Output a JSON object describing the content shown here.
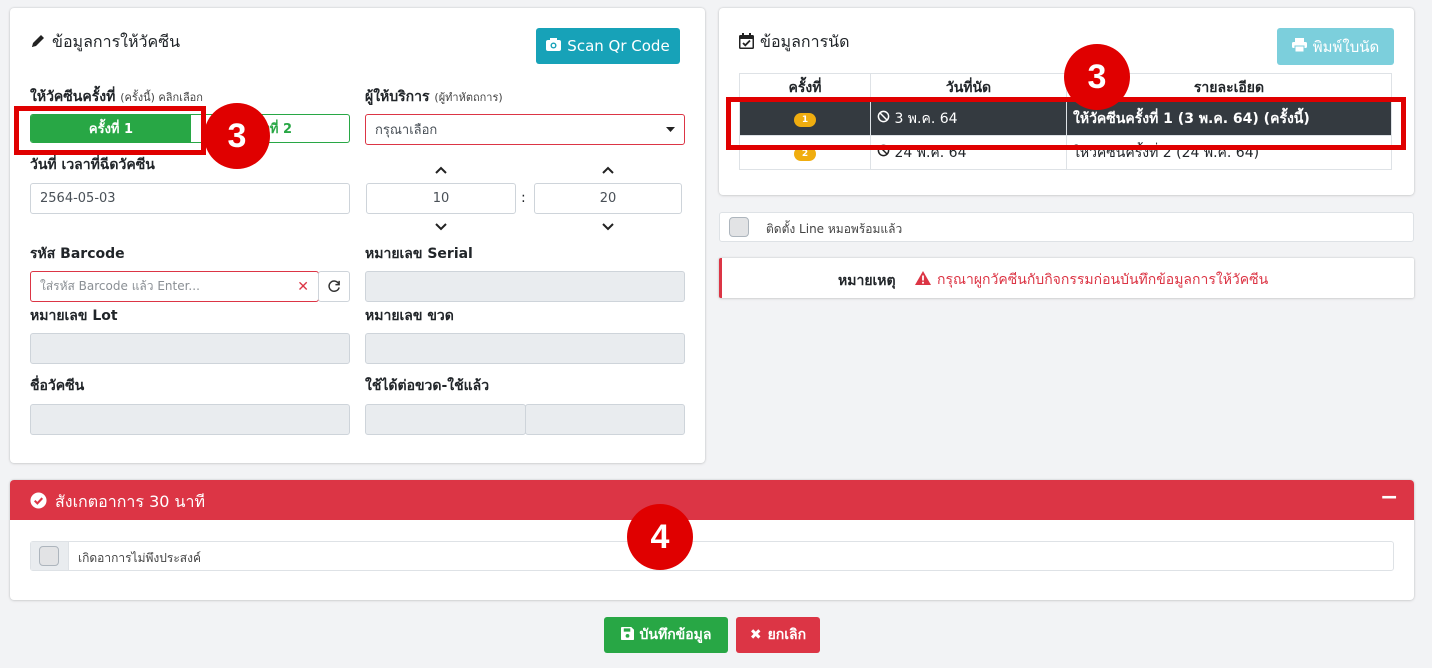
{
  "vaccine": {
    "title": "ข้อมูลการให้วัคซีน",
    "scan_button": "Scan Qr Code",
    "dose": {
      "label": "ให้วัคซีนครั้งที่",
      "hint": "(ครั้งนี้) คลิกเลือก",
      "option1": "ครั้งที่ 1",
      "option2": "ครั้งที่ 2"
    },
    "provider": {
      "label": "ผู้ให้บริการ",
      "hint": "(ผู้ทำหัตถการ)",
      "placeholder": "กรุณาเลือก"
    },
    "datetime": {
      "label": "วันที่ เวลาที่ฉีดวัคซีน",
      "date": "2564-05-03",
      "hour": "10",
      "minute": "20",
      "separator": ":"
    },
    "barcode": {
      "label": "รหัส Barcode",
      "placeholder": "ใส่รหัส Barcode แล้ว Enter..."
    },
    "serial_label": "หมายเลข Serial",
    "lot_label": "หมายเลข Lot",
    "bottle_label": "หมายเลข ขวด",
    "vaccine_name_label": "ชื่อวัคซีน",
    "usage_label": "ใช้ได้ต่อขวด-ใช้แล้ว"
  },
  "appointment": {
    "title": "ข้อมูลการนัด",
    "print_button": "พิมพ์ใบนัด",
    "columns": [
      "ครั้งที่",
      "วันที่นัด",
      "รายละเอียด"
    ],
    "rows": [
      {
        "num": "1",
        "date": "3 พ.ค. 64",
        "detail": "ให้วัคซีนครั้งที่ 1 (3 พ.ค. 64) (ครั้งนี้)"
      },
      {
        "num": "2",
        "date": "24 พ.ค. 64",
        "detail": "ให้วัคซีนครั้งที่ 2 (24 พ.ค. 64)"
      }
    ]
  },
  "line_check": "ติดตั้ง Line หมอพร้อมแล้ว",
  "note": {
    "label": "หมายเหตุ",
    "text": "กรุณาผูกวัคซีนกับกิจกรรมก่อนบันทึกข้อมูลการให้วัคซีน"
  },
  "observe": {
    "title": "สังเกตอาการ 30 นาที",
    "collapse": "−",
    "checkbox": "เกิดอาการไม่พึงประสงค์"
  },
  "footer": {
    "save": "บันทึกข้อมูล",
    "cancel": "ยกเลิก"
  },
  "markers": [
    "3",
    "3",
    "4"
  ],
  "colors": {
    "teal": "#17a2b8",
    "green": "#28a745",
    "danger": "#dc3545",
    "dark": "#343a40",
    "marker": "#e00000"
  }
}
